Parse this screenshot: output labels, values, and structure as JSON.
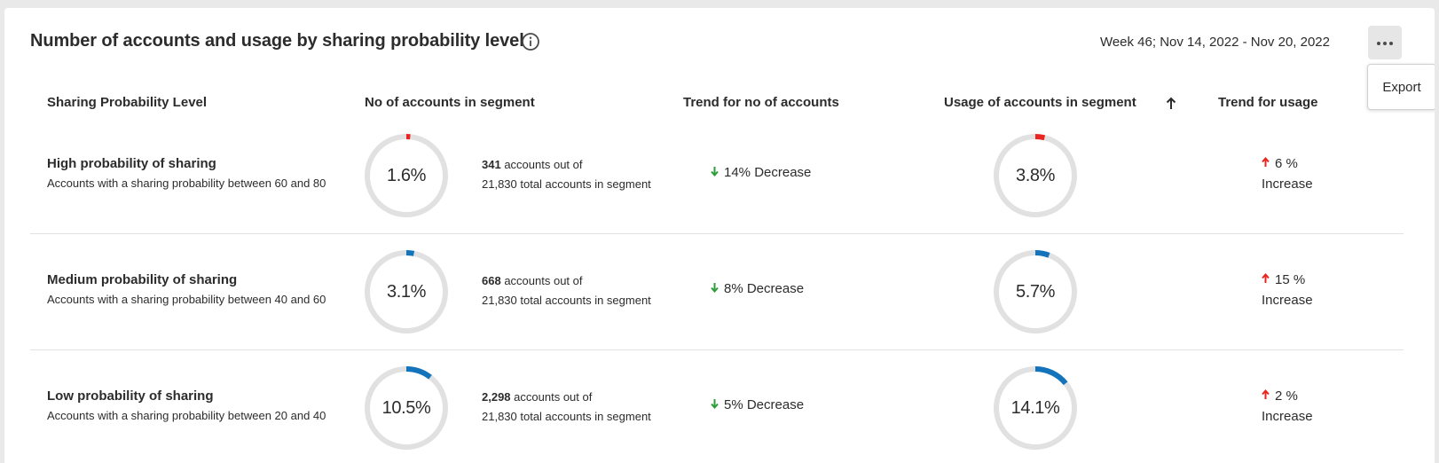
{
  "header": {
    "title": "Number of accounts and usage by sharing probability level",
    "date_range": "Week 46; Nov 14, 2022 - Nov 20, 2022",
    "menu": {
      "export_label": "Export"
    }
  },
  "table": {
    "columns": [
      "Sharing Probability Level",
      "No of accounts in segment",
      "Trend for no of accounts",
      "Usage of accounts in segment",
      "Trend for usage"
    ],
    "rows": [
      {
        "level": "High probability of sharing",
        "description": "Accounts with a sharing probability between 60 and 80",
        "accounts_pct_label": "1.6%",
        "accounts_fraction": 0.016,
        "accounts_count": "341",
        "accounts_out_of": "accounts out of",
        "accounts_total": "21,830 total accounts in segment",
        "trend_accounts": "14% Decrease",
        "usage_pct_label": "3.8%",
        "usage_fraction": 0.038,
        "trend_usage_value": "6 %",
        "trend_usage_word": "Increase",
        "arc_color": "#e8261f"
      },
      {
        "level": "Medium probability of sharing",
        "description": "Accounts with a sharing probability between 40 and 60",
        "accounts_pct_label": "3.1%",
        "accounts_fraction": 0.031,
        "accounts_count": "668",
        "accounts_out_of": "accounts out of",
        "accounts_total": "21,830 total accounts in segment",
        "trend_accounts": "8% Decrease",
        "usage_pct_label": "5.7%",
        "usage_fraction": 0.057,
        "trend_usage_value": "15 %",
        "trend_usage_word": "Increase",
        "arc_color": "#1373bb"
      },
      {
        "level": "Low probability of sharing",
        "description": "Accounts with a sharing probability between 20 and 40",
        "accounts_pct_label": "10.5%",
        "accounts_fraction": 0.105,
        "accounts_count": "2,298",
        "accounts_out_of": "accounts out of",
        "accounts_total": "21,830 total accounts in segment",
        "trend_accounts": "5% Decrease",
        "usage_pct_label": "14.1%",
        "usage_fraction": 0.141,
        "trend_usage_value": "2 %",
        "trend_usage_word": "Increase",
        "arc_color": "#1373bb"
      }
    ]
  },
  "colors": {
    "decrease_arrow": "#2d9d3a",
    "increase_arrow": "#e8261f",
    "donut_track": "#e1e1e1"
  },
  "icons": {
    "info": "info-icon",
    "more": "more-horizontal-icon",
    "sort": "arrow-up-icon",
    "decrease": "arrow-down-icon",
    "increase": "arrow-up-icon"
  }
}
